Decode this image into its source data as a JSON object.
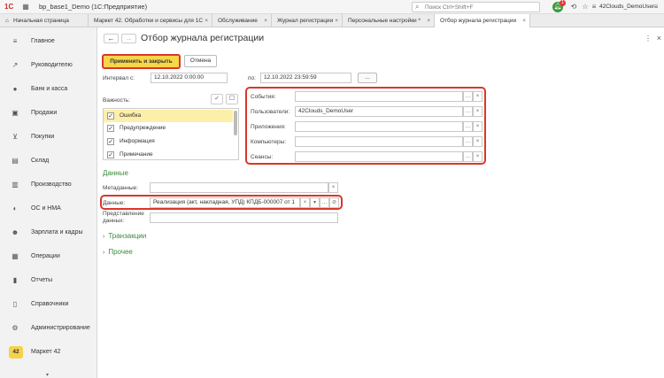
{
  "titlebar": {
    "logo": "1С",
    "app_title": "bp_base1_Demo  (1С:Предприятие)",
    "search_placeholder": "Поиск Ctrl+Shift+F",
    "notifications_count": "1",
    "user": "42Clouds_DemoUser"
  },
  "tabs": [
    {
      "label": "Начальная страница"
    },
    {
      "label": "Маркет 42. Обработки и сервисы для 1С"
    },
    {
      "label": "Обслуживание"
    },
    {
      "label": "Журнал регистрации"
    },
    {
      "label": "Персональные настройки *"
    },
    {
      "label": "Отбор журнала регистрации"
    }
  ],
  "sidebar": {
    "items": [
      {
        "label": "Главное",
        "icon": "menu-icon"
      },
      {
        "label": "Руководителю",
        "icon": "trend-icon"
      },
      {
        "label": "Банк и касса",
        "icon": "bank-icon"
      },
      {
        "label": "Продажи",
        "icon": "bag-icon"
      },
      {
        "label": "Покупки",
        "icon": "cart-icon"
      },
      {
        "label": "Склад",
        "icon": "warehouse-icon"
      },
      {
        "label": "Производство",
        "icon": "factory-icon"
      },
      {
        "label": "ОС и НМА",
        "icon": "assets-icon"
      },
      {
        "label": "Зарплата и кадры",
        "icon": "people-icon"
      },
      {
        "label": "Операции",
        "icon": "operations-icon"
      },
      {
        "label": "Отчеты",
        "icon": "reports-icon"
      },
      {
        "label": "Справочники",
        "icon": "books-icon"
      },
      {
        "label": "Администрирование",
        "icon": "gear-icon"
      },
      {
        "label": "Маркет 42",
        "icon": "market42-icon",
        "badge": "42"
      }
    ]
  },
  "form": {
    "title": "Отбор журнала регистрации",
    "apply_button": "Применить и закрыть",
    "cancel_button": "Отмена",
    "interval_from_label": "Интервал с:",
    "interval_from": "12.10.2022  0:00:00",
    "interval_to_label": "по:",
    "interval_to": "12.10.2022 23:59:59",
    "interval_select": "...",
    "importance_label": "Важность:",
    "levels": [
      {
        "label": "Ошибка",
        "checked": true,
        "selected": true
      },
      {
        "label": "Предупреждение",
        "checked": true
      },
      {
        "label": "Информация",
        "checked": true
      },
      {
        "label": "Примечание",
        "checked": true
      }
    ],
    "events_label": "События:",
    "events_value": "",
    "users_label": "Пользователи:",
    "users_value": "42Clouds_DemoUser",
    "apps_label": "Приложения:",
    "apps_value": "",
    "computers_label": "Компьютеры:",
    "computers_value": "",
    "sessions_label": "Сеансы:",
    "sessions_value": "",
    "data_section": "Данные",
    "metadata_label": "Метаданные:",
    "metadata_value": "",
    "data_label": "Данные:",
    "data_value": "Реализация (акт, накладная, УПД) КПДБ-000007 от 1",
    "data_repr_label": "Представление данных:",
    "data_repr_value": "",
    "transactions_label": "Транзакции",
    "other_label": "Прочее"
  },
  "colors": {
    "accent_yellow": "#f7d64a",
    "highlight_red": "#d9372b",
    "section_green": "#3a8a3a"
  }
}
